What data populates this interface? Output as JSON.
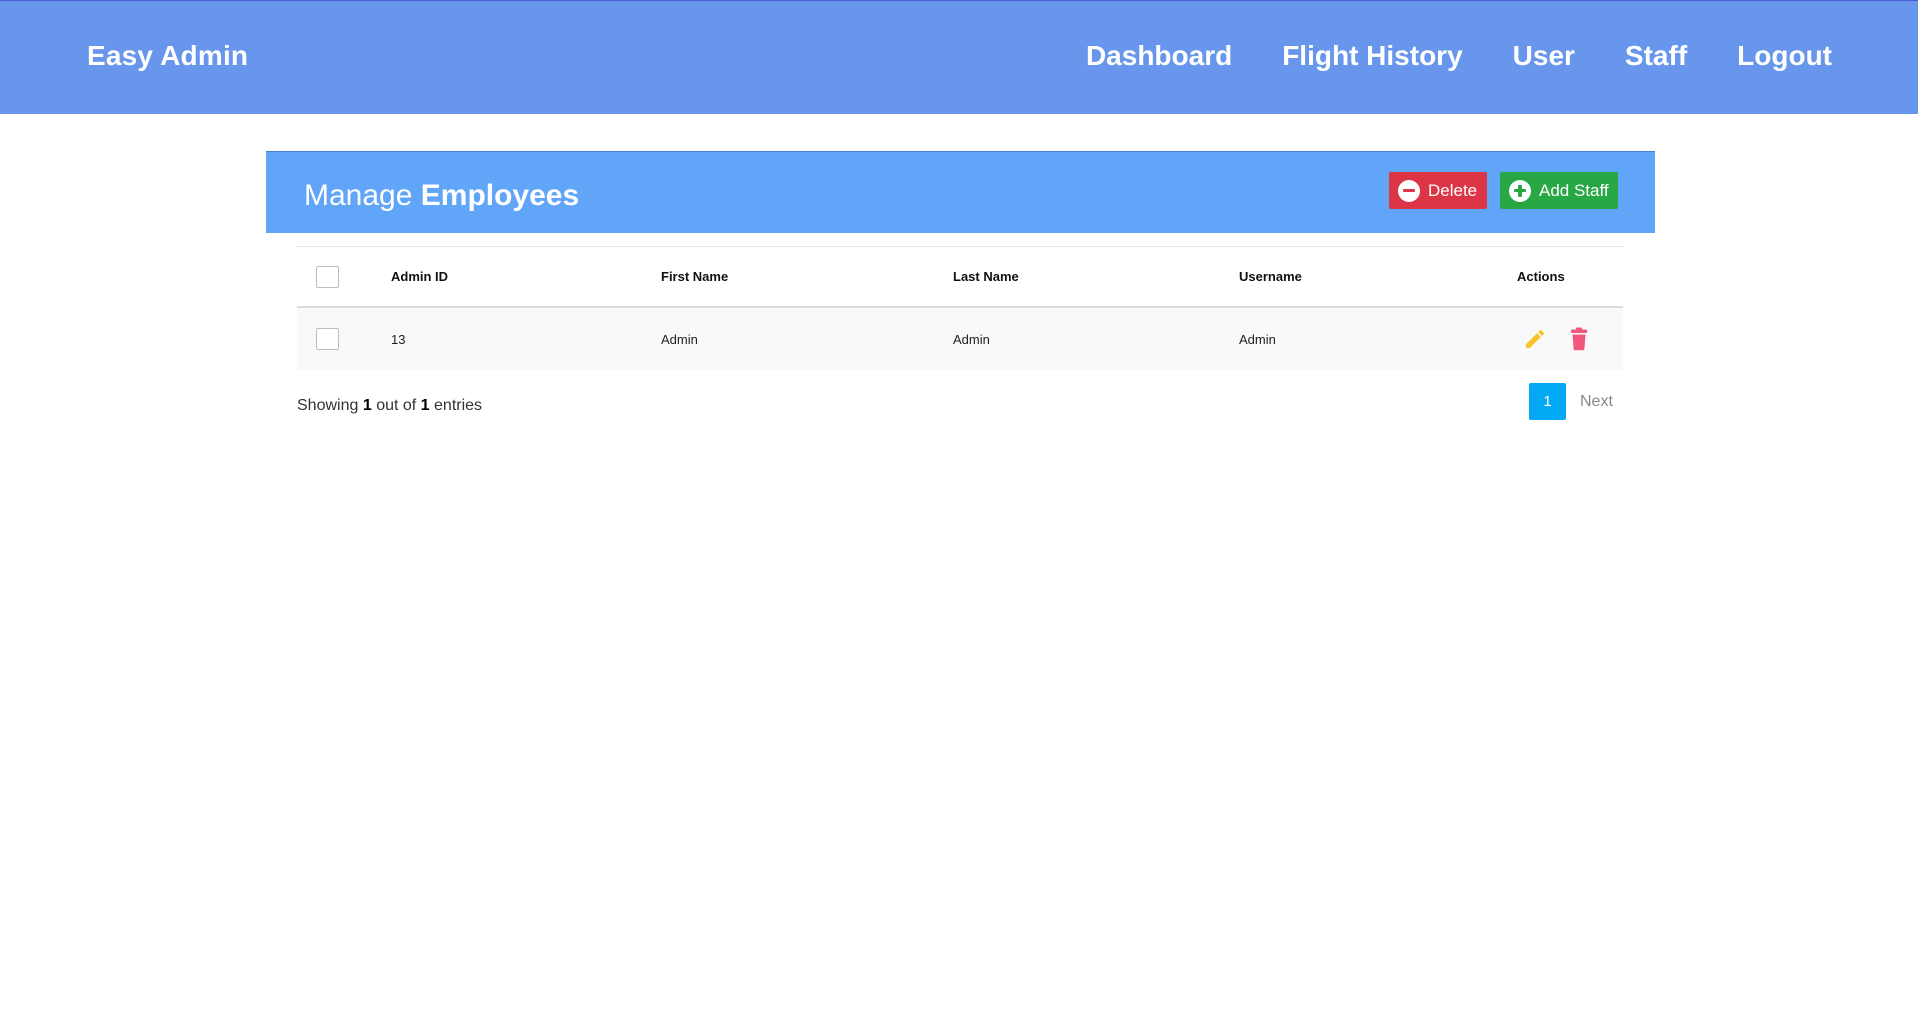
{
  "navbar": {
    "brand": "Easy Admin",
    "links": [
      "Dashboard",
      "Flight History",
      "User",
      "Staff",
      "Logout"
    ]
  },
  "panel": {
    "title_light": "Manage",
    "title_bold": "Employees",
    "delete_label": "Delete",
    "add_label": "Add Staff",
    "colors": {
      "panel": "#61a5f8",
      "delete": "#dc3545",
      "add": "#28a745"
    }
  },
  "table": {
    "headers": {
      "admin_id": "Admin ID",
      "first_name": "First Name",
      "last_name": "Last Name",
      "username": "Username",
      "actions": "Actions"
    },
    "rows": [
      {
        "admin_id": "13",
        "first_name": "Admin",
        "last_name": "Admin",
        "username": "Admin",
        "icons": [
          "pencil-icon",
          "trash-icon"
        ]
      }
    ]
  },
  "footer": {
    "showing": "Showing",
    "shown": "1",
    "out_of": "out of",
    "total": "1",
    "entries": "entries"
  },
  "pagination": {
    "current_page": "1",
    "next_label": "Next",
    "accent": "#03a9f4"
  }
}
